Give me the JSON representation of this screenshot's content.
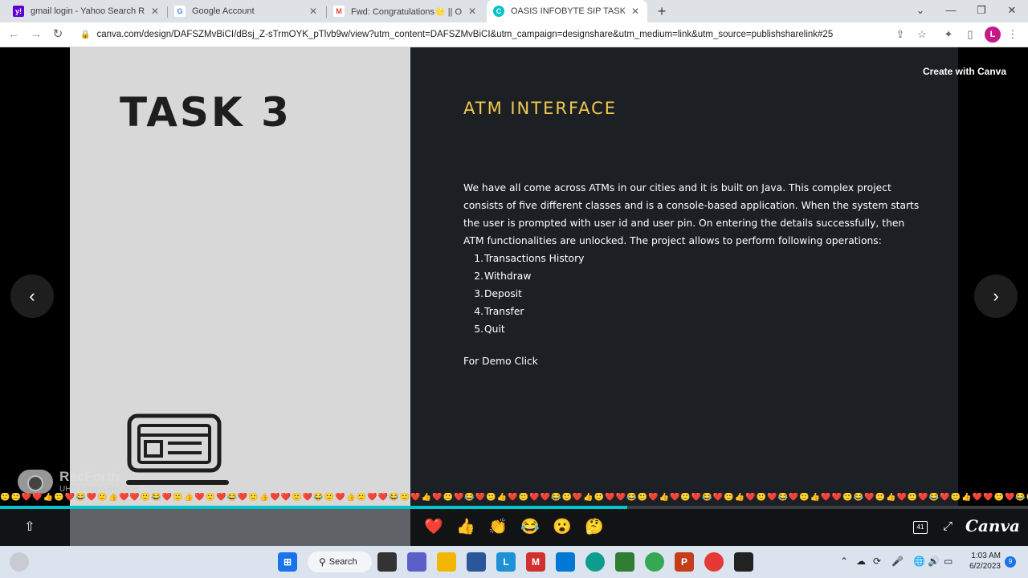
{
  "browser": {
    "tabs": [
      {
        "title": "gmail login - Yahoo Search Results",
        "favicon": "yahoo-icon",
        "color": "#6001d2",
        "glyph": "y!"
      },
      {
        "title": "Google Account",
        "favicon": "google-icon",
        "color": "#4285f4",
        "glyph": "G"
      },
      {
        "title": "Fwd: Congratulations🌟 || Offer",
        "favicon": "gmail-icon",
        "color": "#ea4335",
        "glyph": "M"
      },
      {
        "title": "OASIS INFOBYTE SIP TASK LIST",
        "favicon": "canva-icon",
        "color": "#00c4cc",
        "glyph": "C"
      }
    ],
    "url": "canva.com/design/DAFSZMvBiCI/dBsj_Z-sTrmOYK_pTlvb9w/view?utm_content=DAFSZMvBiCI&utm_campaign=designshare&utm_medium=link&utm_source=publishsharelink#25",
    "profile_initial": "L"
  },
  "slide": {
    "title": "TASK 3",
    "heading": "ATM INTERFACE",
    "body": "We have all come across ATMs in our cities and it is built on Java. This complex project consists of five different classes and is a console-based application. When the system starts the user is prompted with user id and user pin. On entering the details successfully, then ATM functionalities are unlocked. The project allows to perform following operations:",
    "operations": [
      {
        "num": "1.",
        "label": "Transactions History"
      },
      {
        "num": "2.",
        "label": "Withdraw"
      },
      {
        "num": "3.",
        "label": "Deposit"
      },
      {
        "num": "4.",
        "label": "Transfer"
      },
      {
        "num": "5.",
        "label": "Quit"
      }
    ],
    "demo_text": "For Demo Click",
    "colors": {
      "left_bg": "#d8d8d8",
      "right_bg": "#1c2025",
      "heading": "#f2c94c"
    }
  },
  "viewer": {
    "create_button": "Create with Canva",
    "page_count": "41",
    "logo": "Canva",
    "progress_fraction": 0.61,
    "reactions": [
      "❤️",
      "👍",
      "👏",
      "😂",
      "😮",
      "🤔"
    ]
  },
  "overlay": {
    "recorder_name": "RecForth",
    "recorder_sub": "UHD Screen Recorder",
    "emoji_strip": "🙂🙂❤️❤️👍🙂❤️😂❤️🙂👍❤️❤️🙂😂❤️🙂👍❤️🙂❤️😂❤️🙂👍❤️❤️🙂❤️😂🙂❤️👍🙂❤️❤️😂🙂❤️👍❤️🙂❤️😂❤️🙂👍❤️🙂❤️❤️😂🙂❤️👍🙂❤️❤️😂🙂❤️👍❤️🙂❤️😂❤️🙂👍❤️🙂❤️😂❤️🙂👍❤️❤️🙂😂❤️🙂👍❤️🙂❤️😂❤️🙂👍❤️❤️🙂❤️😂🙂❤️👍🙂❤️❤️😂🙂❤️👍❤️🙂"
  },
  "taskbar": {
    "search_label": "Search",
    "time": "1:03 AM",
    "date": "6/2/2023",
    "notification_count": "9"
  }
}
